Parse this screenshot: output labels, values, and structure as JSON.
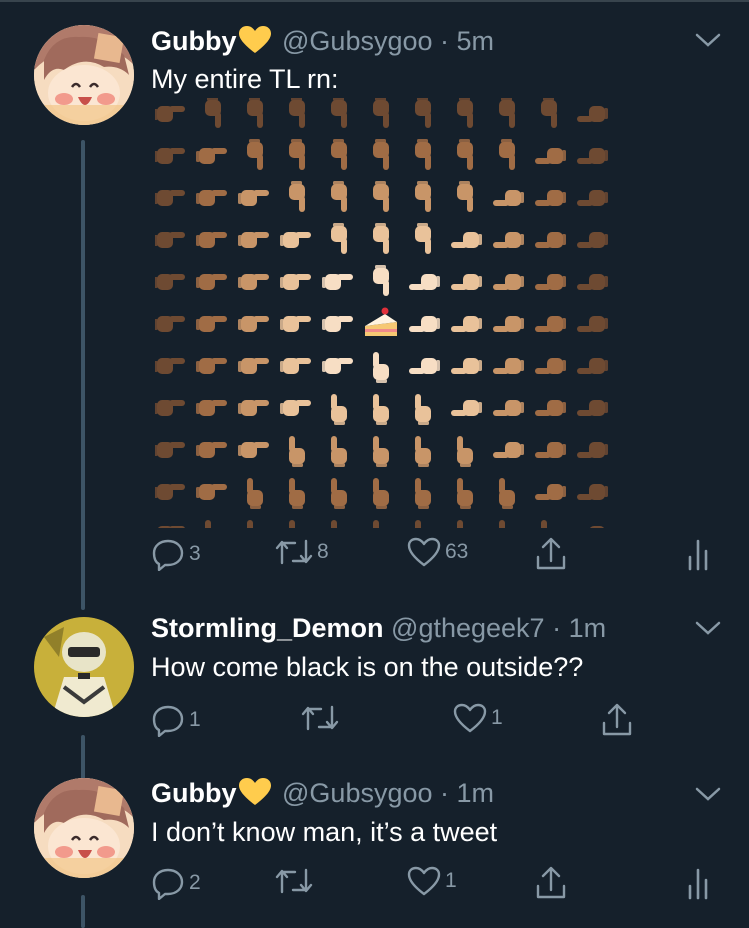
{
  "tweets": [
    {
      "name": "Gubby",
      "handle": "@Gubsygoo",
      "time": "· 5m",
      "text": "My entire TL rn:",
      "replies": "3",
      "retweets": "8",
      "likes": "63"
    },
    {
      "name": "Stormling_Demon",
      "handle": "@gthegeek7",
      "time": "· 1m",
      "text": "How come black is on the outside??",
      "replies": "1",
      "retweets": "",
      "likes": "1"
    },
    {
      "name": "Gubby",
      "handle": "@Gubsygoo",
      "time": "· 1m",
      "text": "I don’t know man, it’s a tweet",
      "replies": "2",
      "retweets": "",
      "likes": "1"
    }
  ],
  "colors": {
    "background": "#15202b",
    "muted": "#8899a6",
    "thread_line": "#3d5466",
    "heart_badge": "#ffcc4d"
  },
  "icons": [
    "reply-icon",
    "retweet-icon",
    "like-icon",
    "share-icon",
    "analytics-icon",
    "chevron-down-icon",
    "yellow-heart-icon",
    "pointing-hand-icon",
    "cake-icon"
  ]
}
